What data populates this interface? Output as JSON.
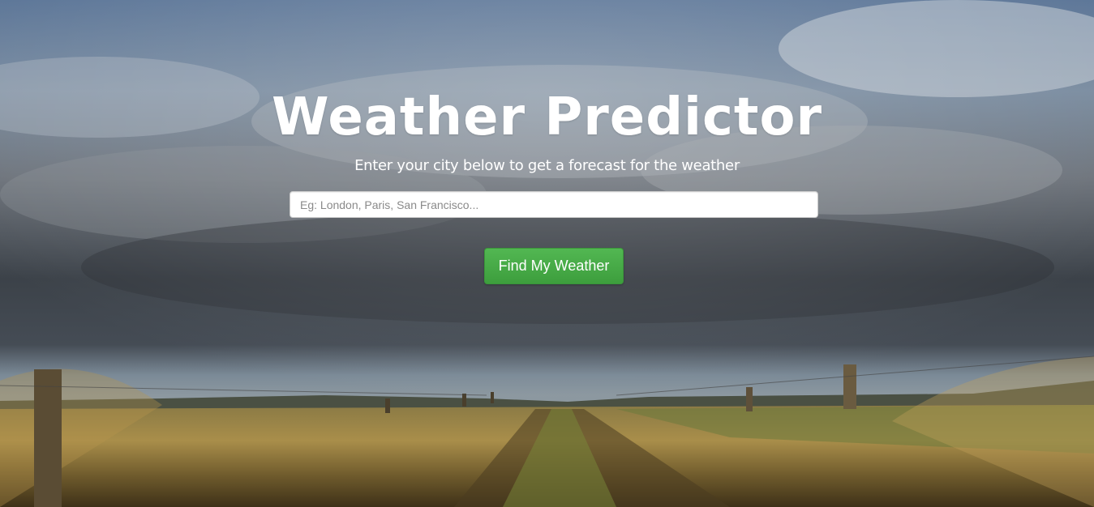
{
  "page": {
    "title": "Weather Predictor",
    "subtitle": "Enter your city below to get a forecast for the weather"
  },
  "search": {
    "placeholder": "Eg: London, Paris, San Francisco...",
    "value": ""
  },
  "actions": {
    "submit_label": "Find My Weather"
  },
  "colors": {
    "button": "#47a947",
    "text": "#ffffff"
  }
}
